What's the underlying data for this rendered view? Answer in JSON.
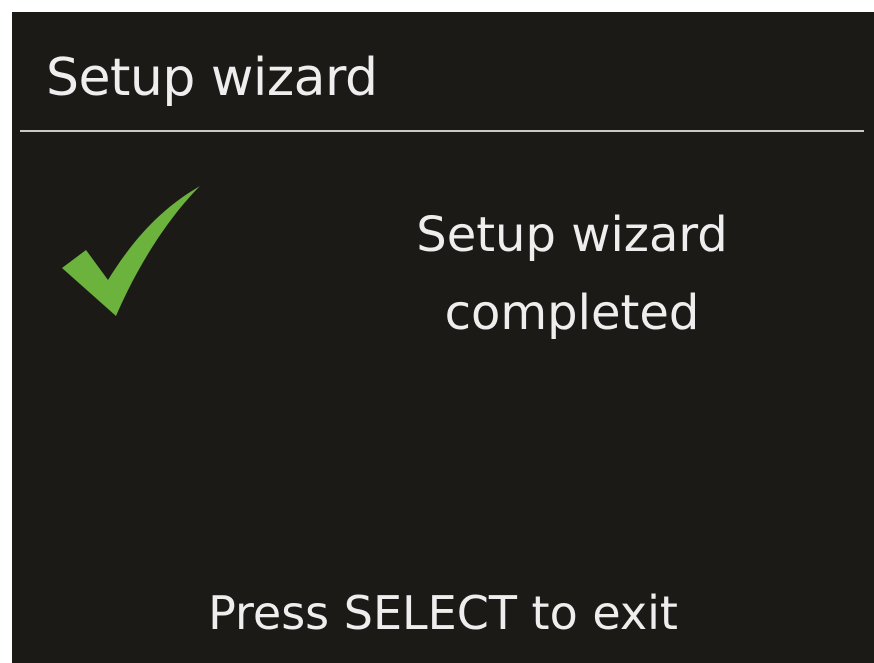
{
  "header": {
    "title": "Setup wizard"
  },
  "status": {
    "icon": "checkmark-icon",
    "icon_color": "#6cb33e",
    "line1": "Setup wizard",
    "line2": "completed"
  },
  "footer": {
    "hint": "Press SELECT to exit"
  },
  "colors": {
    "background": "#1c1a17",
    "text": "#eeeeee",
    "divider": "#c9c9c9"
  }
}
